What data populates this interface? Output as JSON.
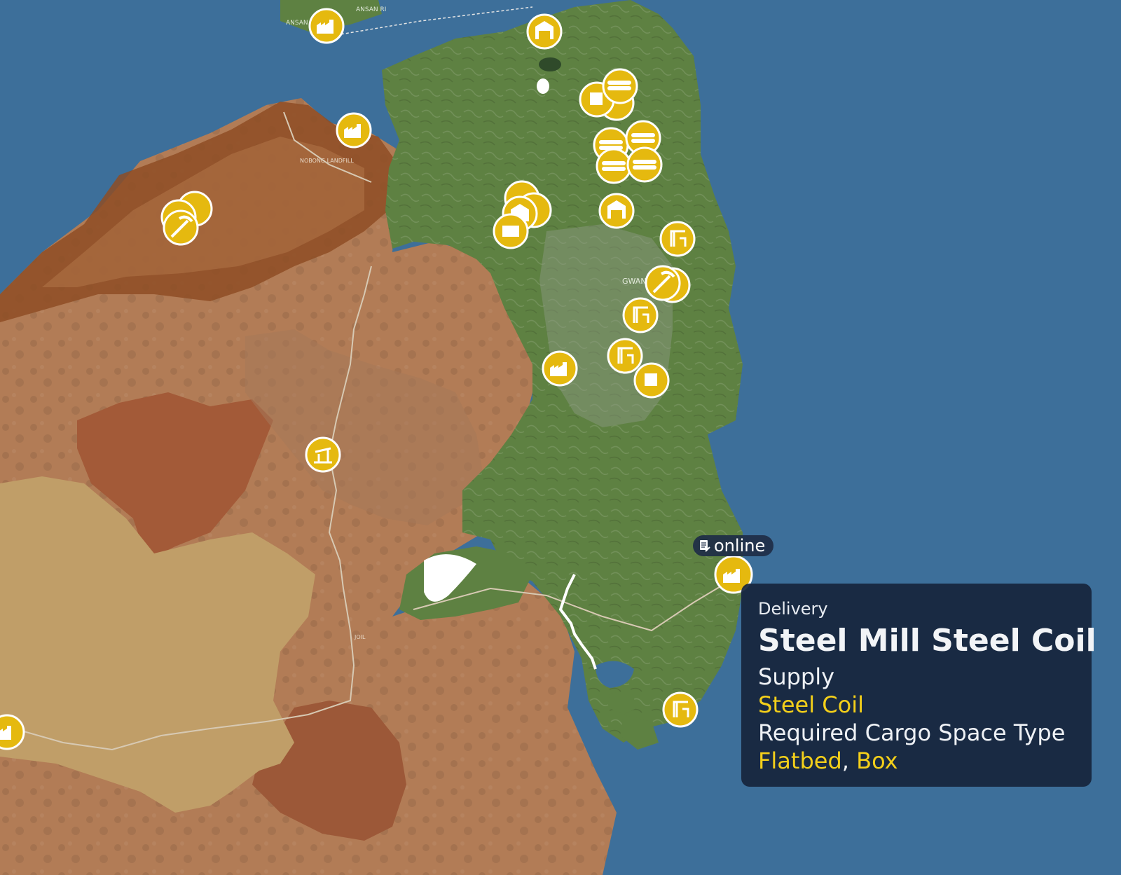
{
  "map": {
    "place_labels": [
      {
        "text": "ANSAN SP"
      },
      {
        "text": "ANSAN RI"
      },
      {
        "text": "NOBONG LANDFILL"
      },
      {
        "text": "GWAN"
      },
      {
        "text": "JOIL"
      }
    ],
    "colors": {
      "sea": "#3d6f9a",
      "forest": "#5d8040",
      "dirt_dark": "#9c5a30",
      "dirt": "#b07a52",
      "sand": "#c2a064",
      "marker_fill": "#e5b90f",
      "marker_ring": "#ffffff"
    },
    "marker_icons": [
      "factory-icon",
      "warehouse-icon",
      "box-icon",
      "logs-icon",
      "pickaxe-icon",
      "crane-icon",
      "oil-pump-icon",
      "building-icon"
    ]
  },
  "selected_label": {
    "icon": "document-edit-icon",
    "text": "online"
  },
  "tooltip": {
    "category": "Delivery",
    "title": "Steel Mill Steel Coil",
    "supply_label": "Supply",
    "supply_value": "Steel Coil",
    "cargo_label": "Required Cargo Space Type",
    "cargo_values": [
      "Flatbed",
      "Box"
    ],
    "cargo_separator": ", "
  }
}
